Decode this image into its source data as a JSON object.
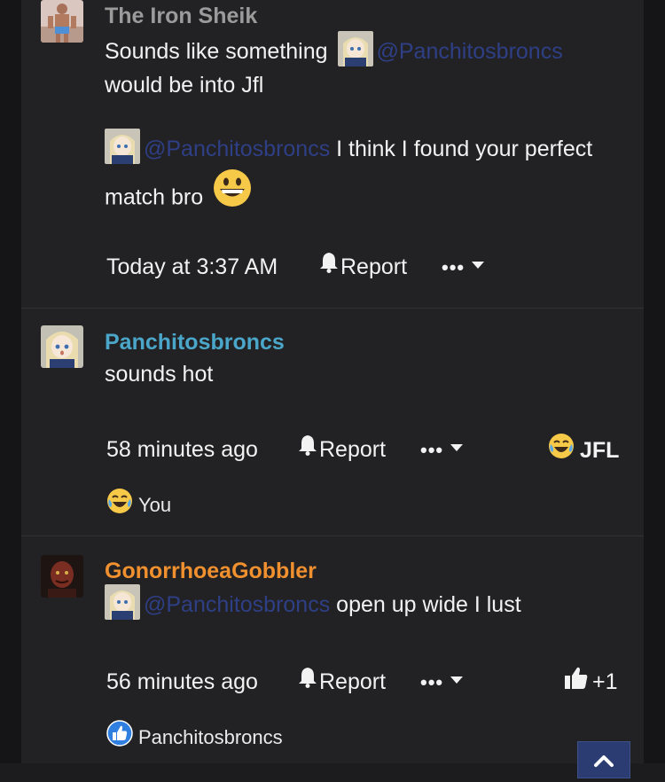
{
  "colors": {
    "background": "#222224",
    "mention": "#2e3f86",
    "username_default": "#9b9b9b",
    "username_panchitos": "#4aa7c9",
    "username_gonorrhoea": "#f0902f"
  },
  "posts": [
    {
      "username": "The Iron Sheik",
      "body": {
        "line1_before": "Sounds like something",
        "line1_mention": "@Panchitosbroncs",
        "line2": "would be into Jfl",
        "line3_mention": "@Panchitosbroncs",
        "line3_after": " I think I found your perfect",
        "line4": "match bro",
        "line4_emoji": "grinning-face-emoji"
      },
      "time": "Today at 3:37 AM",
      "report_label": "Report",
      "more_label": "•••"
    },
    {
      "username": "Panchitosbroncs",
      "body": {
        "text": "sounds hot"
      },
      "time": "58 minutes ago",
      "report_label": "Report",
      "more_label": "•••",
      "reaction_label": "JFL",
      "reaction_icon": "crying-laughing-emoji",
      "reacted_by": "You"
    },
    {
      "username": "GonorrhoeaGobbler",
      "body": {
        "mention": "@Panchitosbroncs",
        "after": " open up wide I lust"
      },
      "time": "56 minutes ago",
      "report_label": "Report",
      "more_label": "•••",
      "reaction_label": "+1",
      "reaction_icon": "thumbs-up-icon",
      "reacted_by": "Panchitosbroncs"
    }
  ]
}
